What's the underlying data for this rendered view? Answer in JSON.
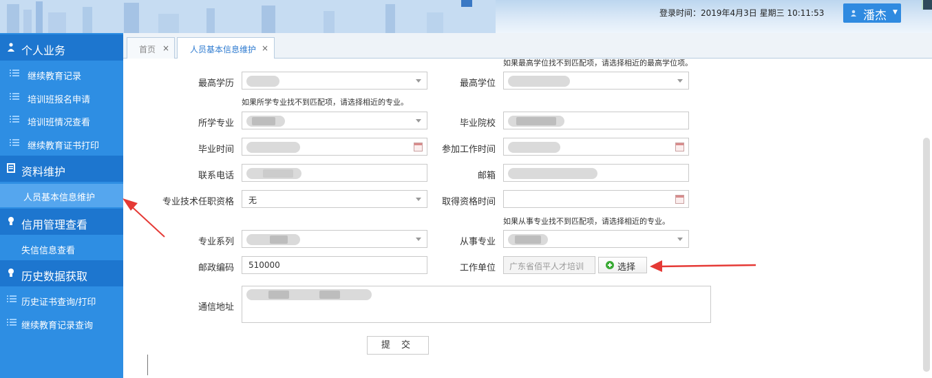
{
  "header": {
    "login_time": "登录时间：2019年4月3日   星期三  10:11:53",
    "user_name": "潘杰",
    "user_icon": "user-icon",
    "caret_icon": "caret-down-icon"
  },
  "sidebar": {
    "sections": [
      {
        "label": "个人业务",
        "icon": "person-icon",
        "items": [
          "继续教育记录",
          "培训班报名申请",
          "培训班情况查看",
          "继续教育证书打印"
        ]
      },
      {
        "label": "资料维护",
        "icon": "document-icon",
        "items": [
          "人员基本信息维护"
        ]
      },
      {
        "label": "信用管理查看",
        "icon": "bulb-icon",
        "items": [
          "失信信息查看"
        ]
      },
      {
        "label": "历史数据获取",
        "icon": "bulb-icon",
        "items": [
          "历史证书查询/打印",
          "继续教育记录查询"
        ]
      }
    ]
  },
  "tabs": [
    {
      "label": "首页",
      "close": "×"
    },
    {
      "label": "人员基本信息维护",
      "close": "×"
    }
  ],
  "form": {
    "hint_degree": "如果最高学位找不到匹配项，请选择相近的最高学位项。",
    "hint_major": "如果所学专业找不到匹配项，请选择相近的专业。",
    "hint_work_major": "如果从事专业找不到匹配项，请选择相近的专业。",
    "labels": {
      "education": "最高学历",
      "degree": "最高学位",
      "major": "所学专业",
      "school": "毕业院校",
      "grad_time": "毕业时间",
      "work_start": "参加工作时间",
      "phone": "联系电话",
      "email": "邮箱",
      "qualification": "专业技术任职资格",
      "qual_time": "取得资格时间",
      "series": "专业系列",
      "work_major": "从事专业",
      "postcode": "邮政编码",
      "employer": "工作单位",
      "address": "通信地址"
    },
    "values": {
      "qualification": "无",
      "postcode": "510000",
      "employer_placeholder": "广东省佰平人才培训"
    },
    "select_button": "选择",
    "submit": "提 交"
  },
  "colors": {
    "sidebar_bg": "#2e8ee3",
    "section_bg": "#1d76cf",
    "accent": "#2f8ae0",
    "annotation_red": "#e53935"
  }
}
